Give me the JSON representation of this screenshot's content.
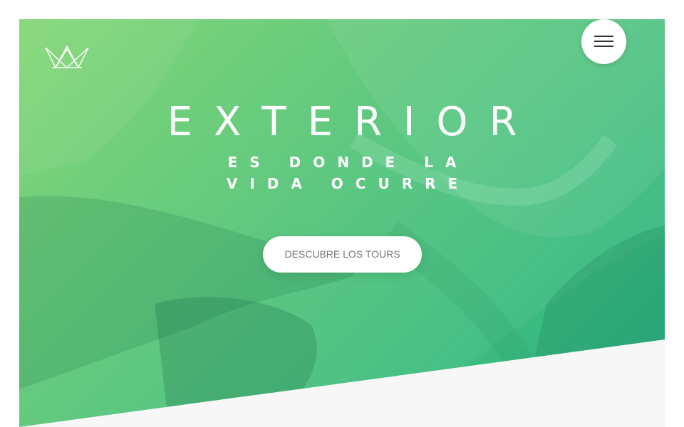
{
  "header": {
    "logo_icon": "crown-logo-icon",
    "menu_icon": "hamburger-menu-icon"
  },
  "hero": {
    "title": "EXTERIOR",
    "subtitle": "ES DONDE LA VIDA OCURRE",
    "cta_label": "DESCUBRE LOS TOURS"
  },
  "colors": {
    "gradient_light": "#7ed56f",
    "gradient_mid": "#55c57a",
    "gradient_dark": "#28b485",
    "section_background": "#f7f7f7",
    "button_text": "#777777"
  }
}
